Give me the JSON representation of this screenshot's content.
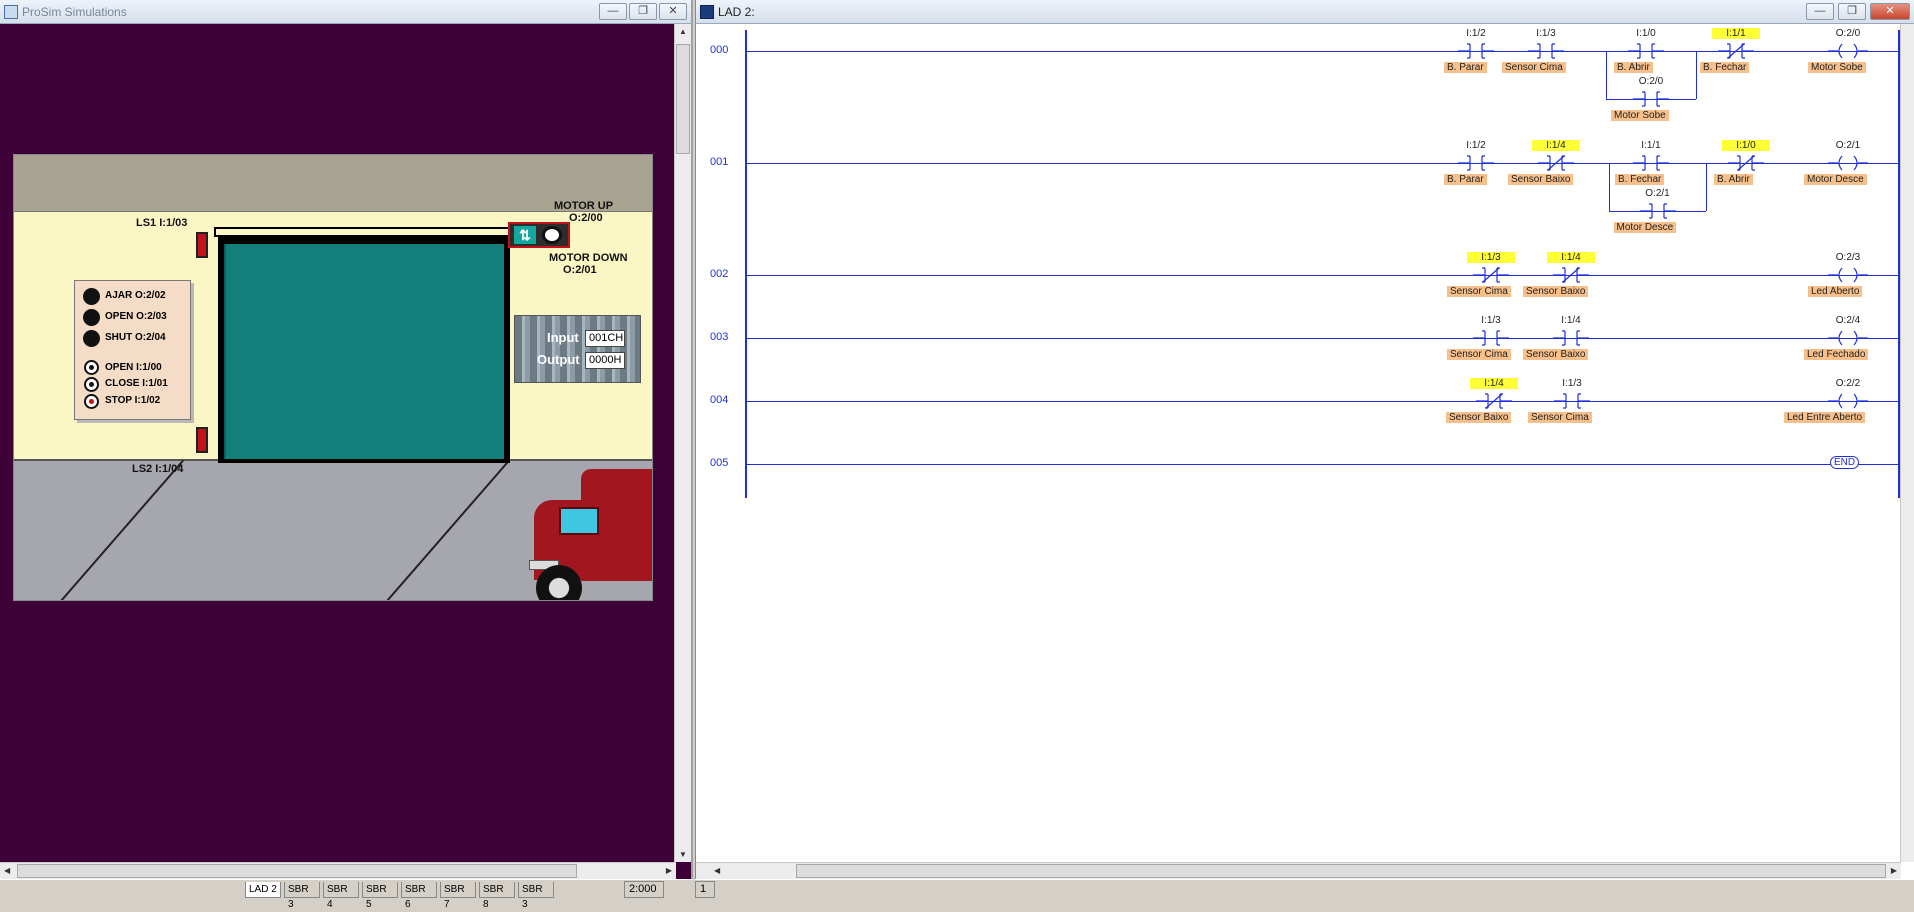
{
  "prosim": {
    "title": "ProSim Simulations",
    "scene": {
      "ls1": "LS1  I:1/03",
      "ls2": "LS2  I:1/04",
      "motor_up": "MOTOR UP",
      "motor_up_addr": "O:2/00",
      "motor_down": "MOTOR DOWN",
      "motor_down_addr": "O:2/01",
      "lamps": [
        {
          "label": "AJAR O:2/02"
        },
        {
          "label": "OPEN  O:2/03"
        },
        {
          "label": "SHUT  O:2/04"
        }
      ],
      "buttons": [
        {
          "label": "OPEN    I:1/00",
          "type": "normal"
        },
        {
          "label": "CLOSE I:1/01",
          "type": "normal"
        },
        {
          "label": "STOP   I:1/02",
          "type": "stop"
        }
      ],
      "input_label": "Input",
      "input_value": "001CH",
      "output_label": "Output",
      "output_value": "0000H"
    }
  },
  "lad": {
    "title": "LAD 2:",
    "rungs": [
      {
        "num": "000",
        "elements": [
          {
            "addr": "I:1/2",
            "sym": "B. Parar",
            "nc": false,
            "hl": false
          },
          {
            "addr": "I:1/3",
            "sym": "Sensor Cima",
            "nc": false,
            "hl": false
          },
          {
            "addr": "I:1/0",
            "sym": "B. Abrir",
            "nc": false,
            "hl": false
          },
          {
            "addr": "I:1/1",
            "sym": "B. Fechar",
            "nc": true,
            "hl": true
          }
        ],
        "branch": {
          "addr": "O:2/0",
          "sym": "Motor Sobe"
        },
        "coil": {
          "addr": "O:2/0",
          "sym": "Motor Sobe"
        }
      },
      {
        "num": "001",
        "elements": [
          {
            "addr": "I:1/2",
            "sym": "B. Parar",
            "nc": false,
            "hl": false
          },
          {
            "addr": "I:1/4",
            "sym": "Sensor Baixo",
            "nc": true,
            "hl": true
          },
          {
            "addr": "I:1/1",
            "sym": "B. Fechar",
            "nc": false,
            "hl": false
          },
          {
            "addr": "I:1/0",
            "sym": "B. Abrir",
            "nc": true,
            "hl": true
          }
        ],
        "branch": {
          "addr": "O:2/1",
          "sym": "Motor Desce"
        },
        "coil": {
          "addr": "O:2/1",
          "sym": "Motor Desce"
        }
      },
      {
        "num": "002",
        "elements": [
          {
            "addr": "I:1/3",
            "sym": "Sensor Cima",
            "nc": true,
            "hl": true
          },
          {
            "addr": "I:1/4",
            "sym": "Sensor Baixo",
            "nc": true,
            "hl": true
          }
        ],
        "coil": {
          "addr": "O:2/3",
          "sym": "Led Aberto"
        }
      },
      {
        "num": "003",
        "elements": [
          {
            "addr": "I:1/3",
            "sym": "Sensor Cima",
            "nc": false,
            "hl": false
          },
          {
            "addr": "I:1/4",
            "sym": "Sensor Baixo",
            "nc": false,
            "hl": false
          }
        ],
        "coil": {
          "addr": "O:2/4",
          "sym": "Led Fechado"
        }
      },
      {
        "num": "004",
        "elements": [
          {
            "addr": "I:1/4",
            "sym": "Sensor Baixo",
            "nc": true,
            "hl": true
          },
          {
            "addr": "I:1/3",
            "sym": "Sensor Cima",
            "nc": false,
            "hl": false
          }
        ],
        "coil": {
          "addr": "O:2/2",
          "sym": "Led Entre Aberto"
        }
      },
      {
        "num": "005",
        "elements": [],
        "coil": {
          "addr": "",
          "sym": "END",
          "end": true
        }
      }
    ]
  },
  "statusbar": {
    "tabs": [
      "LAD 2",
      "SBR 3",
      "SBR 4",
      "SBR 5",
      "SBR 6",
      "SBR 7",
      "SBR 8",
      "SBR 3"
    ],
    "active_tab": "LAD 2",
    "position": "2:000",
    "right_cell": "1"
  }
}
